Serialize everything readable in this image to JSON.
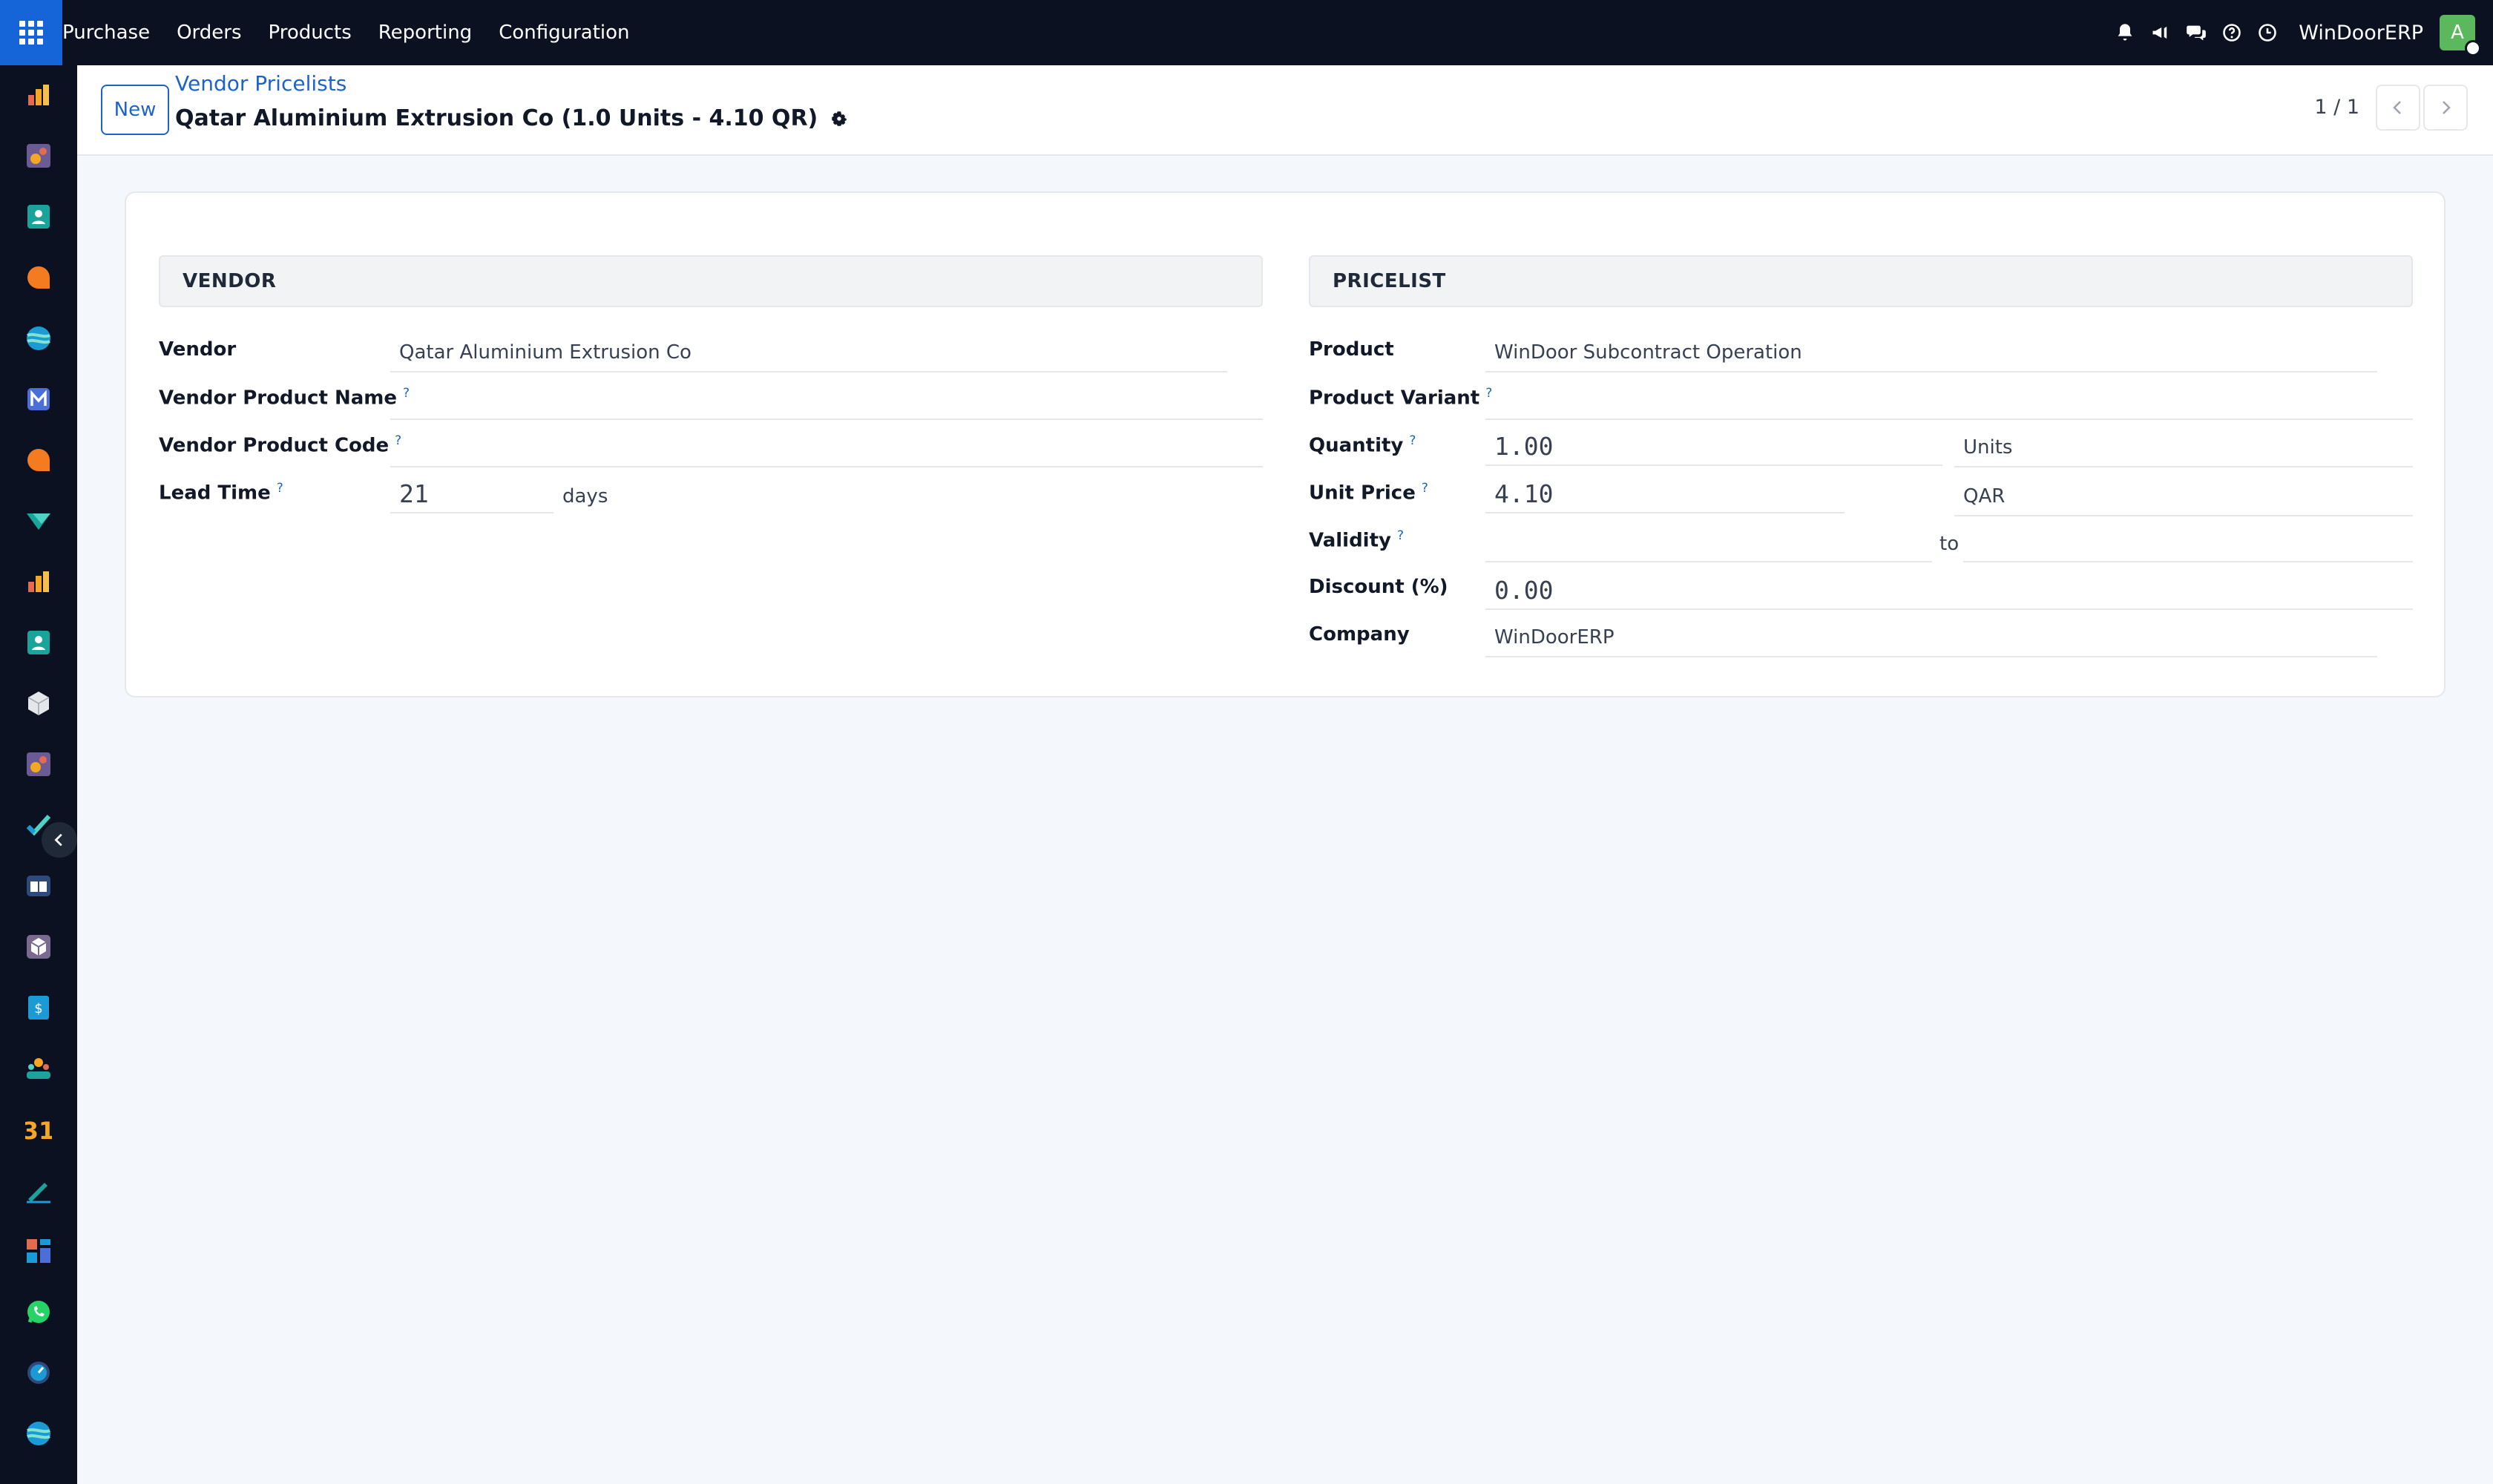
{
  "navbar": {
    "menu": [
      "Purchase",
      "Orders",
      "Products",
      "Reporting",
      "Configuration"
    ],
    "company": "WinDoorERP",
    "avatar_letter": "A",
    "accent": "#1565d8"
  },
  "sidebar": {
    "icons": [
      "purchase-app-icon",
      "sales-app-icon",
      "contacts-app-icon",
      "discuss-app-icon",
      "website-app-icon",
      "email-marketing-app-icon",
      "livechat-app-icon",
      "project-app-icon",
      "reporting-app-icon",
      "employees-app-icon",
      "inventory-app-icon",
      "sales-app-icon-2",
      "planning-app-icon",
      "knowledge-app-icon",
      "manufacturing-app-icon",
      "accounting-app-icon",
      "recruitment-app-icon",
      "calendar-app-icon",
      "sign-app-icon",
      "dashboards-app-icon",
      "whatsapp-app-icon",
      "timesheet-app-icon",
      "website-app-icon-2"
    ],
    "calendar_day": "31"
  },
  "control": {
    "new_label": "New",
    "breadcrumb": "Vendor Pricelists",
    "title": "Qatar Aluminium Extrusion Co (1.0 Units - 4.10 QR)",
    "pager": "1 / 1"
  },
  "vendor_group": {
    "header": "VENDOR",
    "vendor_label": "Vendor",
    "vendor_value": "Qatar Aluminium Extrusion Co",
    "product_name_label": "Vendor Product Name",
    "product_name_value": "",
    "product_code_label": "Vendor Product Code",
    "product_code_value": "",
    "lead_time_label": "Lead Time",
    "lead_time_value": "21",
    "lead_time_unit": "days"
  },
  "pricelist_group": {
    "header": "PRICELIST",
    "product_label": "Product",
    "product_value": "WinDoor Subcontract Operation",
    "variant_label": "Product Variant",
    "variant_value": "",
    "quantity_label": "Quantity",
    "quantity_value": "1.00",
    "uom_value": "Units",
    "unit_price_label": "Unit Price",
    "unit_price_value": "4.10",
    "currency_value": "QAR",
    "validity_label": "Validity",
    "validity_from": "",
    "validity_to_label": "to",
    "validity_to": "",
    "discount_label": "Discount (%)",
    "discount_value": "0.00",
    "company_label": "Company",
    "company_value": "WinDoorERP"
  },
  "help_mark": "?"
}
